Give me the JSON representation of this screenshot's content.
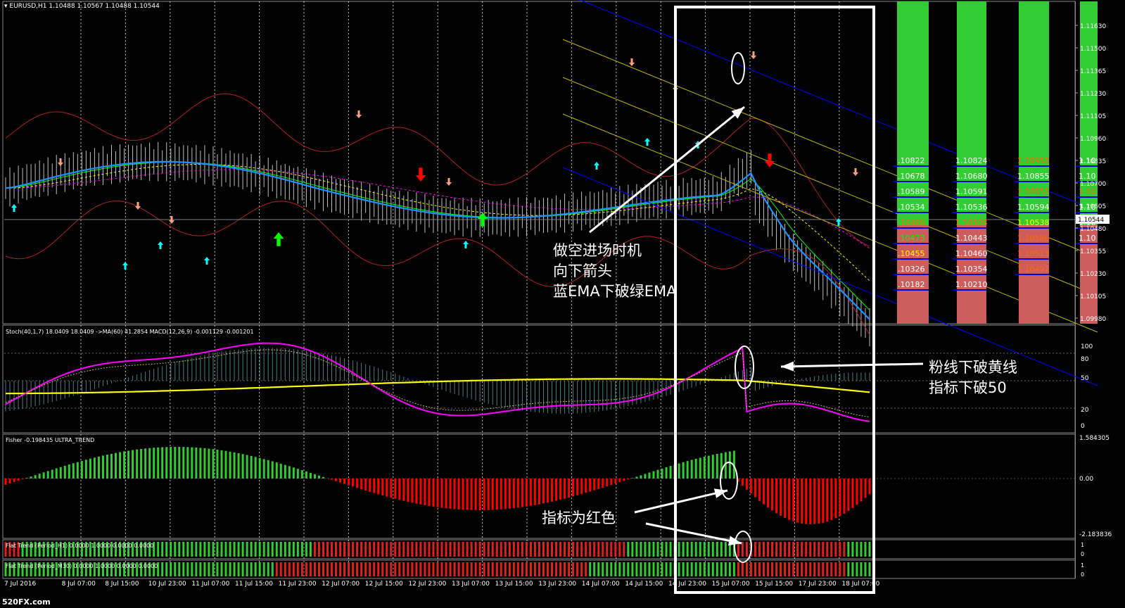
{
  "chart": {
    "main_header": "EURUSD,H1  1.10488 1.10567 1.10488 1.10544",
    "stoch_header": "Stoch(40,1,7) 18.0409 18.0409  ->MA(60) 41.2854  MACD(12,26,9) -0.001129 -0.001201",
    "fisher_header": "Fisher -0.198435  ULTRA_TREND",
    "flat_h1_header": "Flat Trend (Period_H1) 0.0000 1.0000 0.0000 0.0000",
    "flat_m30_header": "Flat Trend (Period_M30) 0.0000 1.0000 0.0000 0.0000",
    "current_price": "1.10544",
    "watermark": "520FX.com"
  },
  "price_axis": [
    "1.11630",
    "1.11500",
    "1.11365",
    "1.11230",
    "1.11105",
    "1.10960",
    "1.10835",
    "1.10700",
    "1.10605",
    "1.10480",
    "1.10355",
    "1.10230",
    "1.10105",
    "1.09980"
  ],
  "stoch_axis": [
    "100",
    "80",
    "50",
    "20",
    "0"
  ],
  "fisher_axis": [
    "1.584305",
    "0.00",
    "-2.183836"
  ],
  "flat_axis": [
    "1",
    "0",
    "1",
    "0"
  ],
  "time_axis": [
    "7 Jul 2016",
    "8 Jul 07:00",
    "8 Jul 15:00",
    "10 Jul 23:00",
    "11 Jul 07:00",
    "11 Jul 15:00",
    "11 Jul 23:00",
    "12 Jul 07:00",
    "12 Jul 15:00",
    "12 Jul 23:00",
    "13 Jul 07:00",
    "13 Jul 15:00",
    "13 Jul 23:00",
    "14 Jul 07:00",
    "14 Jul 15:00",
    "14 Jul 23:00",
    "15 Jul 07:00",
    "15 Jul 15:00",
    "17 Jul 23:00",
    "18 Jul 07:00"
  ],
  "level_columns": [
    {
      "name": "col-1",
      "levels": [
        {
          "label": ".10822",
          "color": "#ffffff"
        },
        {
          "label": ".10678",
          "color": "#ffffff"
        },
        {
          "label": ".10589",
          "color": "#ffffff"
        },
        {
          "label": ".10534",
          "color": "#ffffff"
        },
        {
          "label": ".10480",
          "color": "#ff6a00"
        },
        {
          "label": ".10473",
          "color": "#00ff00"
        },
        {
          "label": ".10455",
          "color": "#ffff00"
        },
        {
          "label": ".10326",
          "color": "#ffffff"
        },
        {
          "label": ".10182",
          "color": "#ffffff"
        }
      ]
    },
    {
      "name": "col-2",
      "levels": [
        {
          "label": "1.10824",
          "color": "#ffffff"
        },
        {
          "label": "1.10680",
          "color": "#ffffff"
        },
        {
          "label": "1.10591",
          "color": "#ffffff"
        },
        {
          "label": "1.10536",
          "color": "#ffffff"
        },
        {
          "label": "1.10508",
          "color": "#ff6a00"
        },
        {
          "label": "1.10443",
          "color": "#ffffff"
        },
        {
          "label": "1.10460",
          "color": "#ffffff"
        },
        {
          "label": "1.10354",
          "color": "#ffffff"
        },
        {
          "label": "1.10210",
          "color": "#ffffff"
        }
      ]
    },
    {
      "name": "col-3",
      "levels": [
        {
          "label": "1.10958",
          "color": "#ff6a00"
        },
        {
          "label": "1.10855",
          "color": "#ffffff"
        },
        {
          "label": "1.10852",
          "color": "#ff6a00"
        },
        {
          "label": "1.10594",
          "color": "#ffffff"
        },
        {
          "label": "1.10538",
          "color": "#ffff00"
        },
        {
          "label": "1.10586",
          "color": "#ff6a00"
        },
        {
          "label": "1.10513",
          "color": "#ff6a00"
        },
        {
          "label": "1.10491",
          "color": "#ff6a00"
        }
      ]
    },
    {
      "name": "col-4",
      "levels": [
        {
          "label": "1.10",
          "color": "#ffffff"
        },
        {
          "label": "1.10",
          "color": "#ffffff"
        },
        {
          "label": "1.10",
          "color": "#ff6a00"
        },
        {
          "label": "1.10",
          "color": "#ffffff"
        },
        {
          "label": "1.10",
          "color": "#ffffff"
        },
        {
          "label": "1.10",
          "color": "#ffffff"
        }
      ]
    }
  ],
  "annotations": {
    "entry": [
      "做空进场时机",
      "向下箭头",
      "蓝EMA下破绿EMA"
    ],
    "stoch": [
      "粉线下破黄线",
      "指标下破50"
    ],
    "fisher": "指标为红色"
  },
  "colors": {
    "background": "#000000",
    "grid": "#ffffff",
    "bull_green": "#32cd32",
    "bear_red": "#cd5c5c",
    "ema_blue": "#1e90ff",
    "ema_green": "#00ff00",
    "ma_yellow": "#ffff00",
    "ma_magenta": "#ff00ff",
    "bollinger": "#b22222",
    "channel_blue": "#0000ff",
    "channel_yellow": "#bdb700",
    "stoch_line": "#ff00ff",
    "signal_line": "#ffff00",
    "fisher_up": "#32cd32",
    "fisher_down": "#ff0000",
    "arrow_up_big": "#00ff00",
    "arrow_down_big": "#ff0000",
    "arrow_up_small": "#00ffff",
    "arrow_down_small": "#ffa07a",
    "highlight_box": "#ffffff"
  }
}
